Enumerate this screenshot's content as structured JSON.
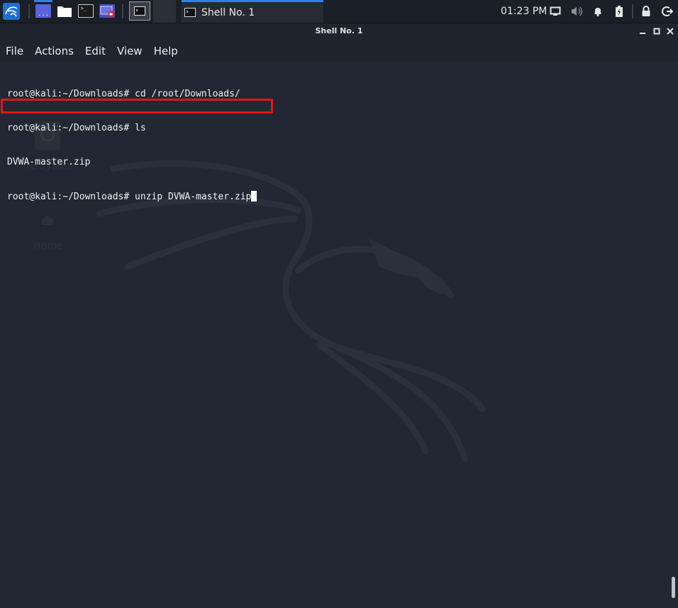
{
  "panel": {
    "launchers": [
      {
        "icon": "workspace-desktop-icon",
        "label": "..."
      },
      {
        "icon": "file-manager-icon"
      },
      {
        "icon": "terminal-icon",
        "glyph": ">_"
      },
      {
        "icon": "screen-recorder-icon"
      }
    ],
    "active_window_icon": "terminal-icon",
    "taskbar_item_label": "Shell No. 1",
    "clock": "01:23 PM",
    "tray_icons": [
      "display-icon",
      "volume-icon",
      "notification-bell-icon",
      "battery-icon",
      "lock-icon",
      "logout-icon"
    ]
  },
  "window": {
    "title": "Shell No. 1",
    "controls": [
      "minimize-icon",
      "maximize-icon",
      "close-icon"
    ]
  },
  "menubar": [
    "File",
    "Actions",
    "Edit",
    "View",
    "Help"
  ],
  "terminal": {
    "lines": [
      "root@kali:~/Downloads# cd /root/Downloads/",
      "root@kali:~/Downloads# ls",
      "DVWA-master.zip",
      "root@kali:~/Downloads# unzip DVWA-master.zip"
    ],
    "highlight_color": "#e0141c"
  },
  "desktop_ghost": {
    "icons": [
      {
        "label": "File System",
        "icon": "drive-icon"
      },
      {
        "label": "Home",
        "icon": "home-folder-icon"
      }
    ]
  },
  "colors": {
    "terminal_bg": "#222733",
    "panel_bg": "#1b1f27",
    "accent": "#2f80ed"
  }
}
